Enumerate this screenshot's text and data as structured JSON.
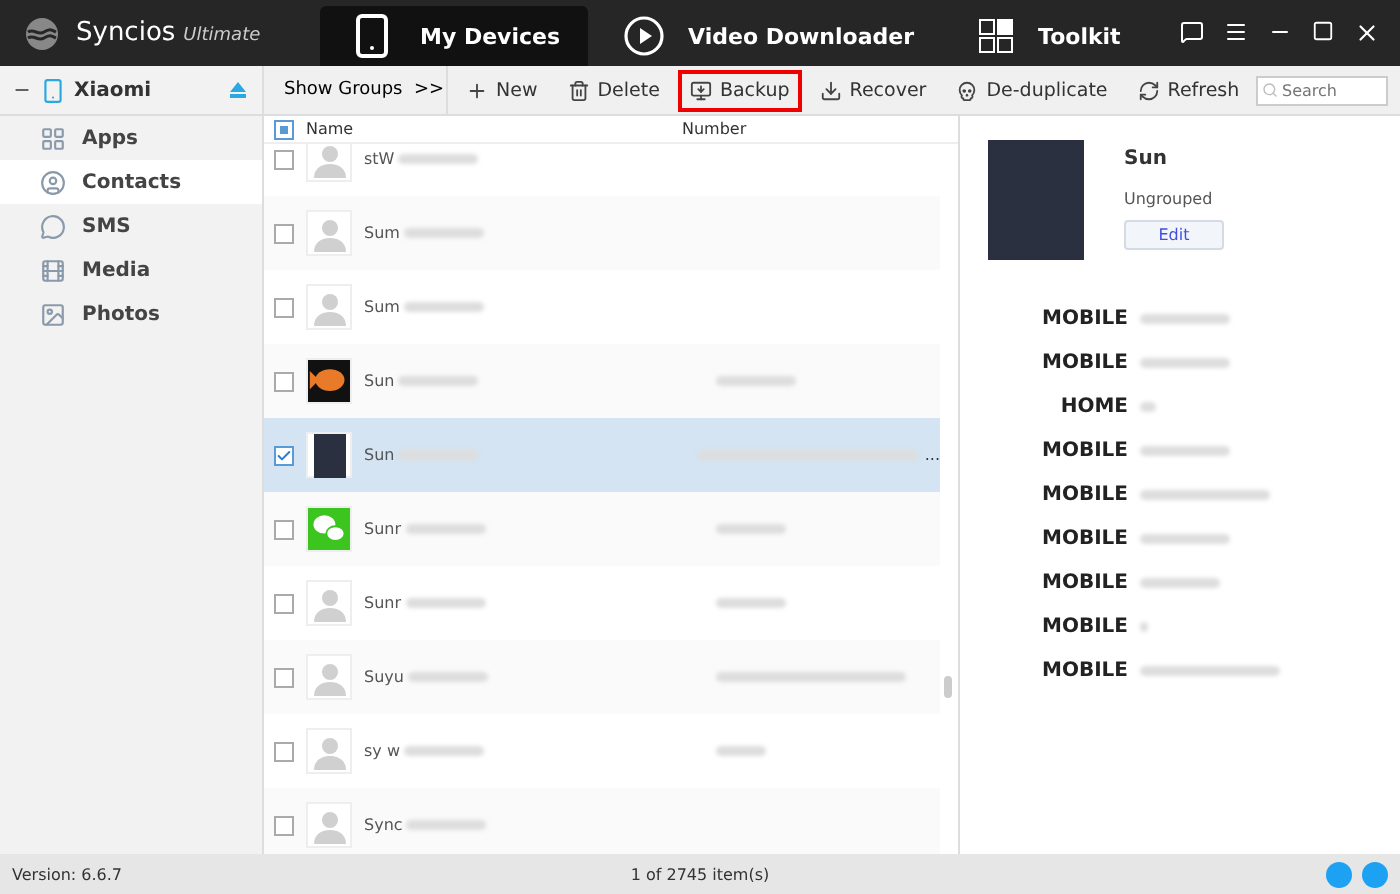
{
  "app": {
    "name": "Syncios",
    "edition": "Ultimate"
  },
  "nav_tabs": [
    {
      "label": "My Devices",
      "selected": true
    },
    {
      "label": "Video Downloader",
      "selected": false
    },
    {
      "label": "Toolkit",
      "selected": false
    }
  ],
  "device": {
    "name": "Xiaomi"
  },
  "sidebar": {
    "items": [
      {
        "label": "Apps",
        "selected": false
      },
      {
        "label": "Contacts",
        "selected": true
      },
      {
        "label": "SMS",
        "selected": false
      },
      {
        "label": "Media",
        "selected": false
      },
      {
        "label": "Photos",
        "selected": false
      }
    ]
  },
  "toolbar": {
    "show_groups": "Show Groups  >>",
    "actions": [
      {
        "label": "New",
        "highlighted": false
      },
      {
        "label": "Delete",
        "highlighted": false
      },
      {
        "label": "Backup",
        "highlighted": true
      },
      {
        "label": "Recover",
        "highlighted": false
      },
      {
        "label": "De-duplicate",
        "highlighted": false
      },
      {
        "label": "Refresh",
        "highlighted": false
      }
    ],
    "search": {
      "placeholder": "Search"
    }
  },
  "table": {
    "select_all_partial": true,
    "columns": [
      "Name",
      "Number"
    ],
    "rows": [
      {
        "name": "stW",
        "kind": "person",
        "checked": false,
        "selected": false,
        "number_more": ""
      },
      {
        "name": "Sum",
        "kind": "person",
        "checked": false,
        "selected": false,
        "number_more": ""
      },
      {
        "name": "Sum",
        "kind": "person",
        "checked": false,
        "selected": false,
        "number_more": ""
      },
      {
        "name": "Sun",
        "kind": "fish",
        "checked": false,
        "selected": false,
        "number_more": ""
      },
      {
        "name": "Sun",
        "kind": "photo",
        "checked": true,
        "selected": true,
        "number_more": "..."
      },
      {
        "name": "Sunr",
        "kind": "chat",
        "checked": false,
        "selected": false,
        "number_more": ""
      },
      {
        "name": "Sunr",
        "kind": "person",
        "checked": false,
        "selected": false,
        "number_more": ""
      },
      {
        "name": "Suyu",
        "kind": "person",
        "checked": false,
        "selected": false,
        "number_more": ""
      },
      {
        "name": "sy w",
        "kind": "person",
        "checked": false,
        "selected": false,
        "number_more": ""
      },
      {
        "name": "Sync",
        "kind": "person",
        "checked": false,
        "selected": false,
        "number_more": ""
      }
    ]
  },
  "detail": {
    "name": "Sun",
    "group": "Ungrouped",
    "edit_button": "Edit",
    "fields": [
      {
        "label": "MOBILE"
      },
      {
        "label": "MOBILE"
      },
      {
        "label": "HOME"
      },
      {
        "label": "MOBILE"
      },
      {
        "label": "MOBILE"
      },
      {
        "label": "MOBILE"
      },
      {
        "label": "MOBILE"
      },
      {
        "label": "MOBILE"
      },
      {
        "label": "MOBILE"
      }
    ]
  },
  "status_bar": {
    "version": "Version: 6.6.7",
    "count": "1 of 2745 item(s)"
  }
}
